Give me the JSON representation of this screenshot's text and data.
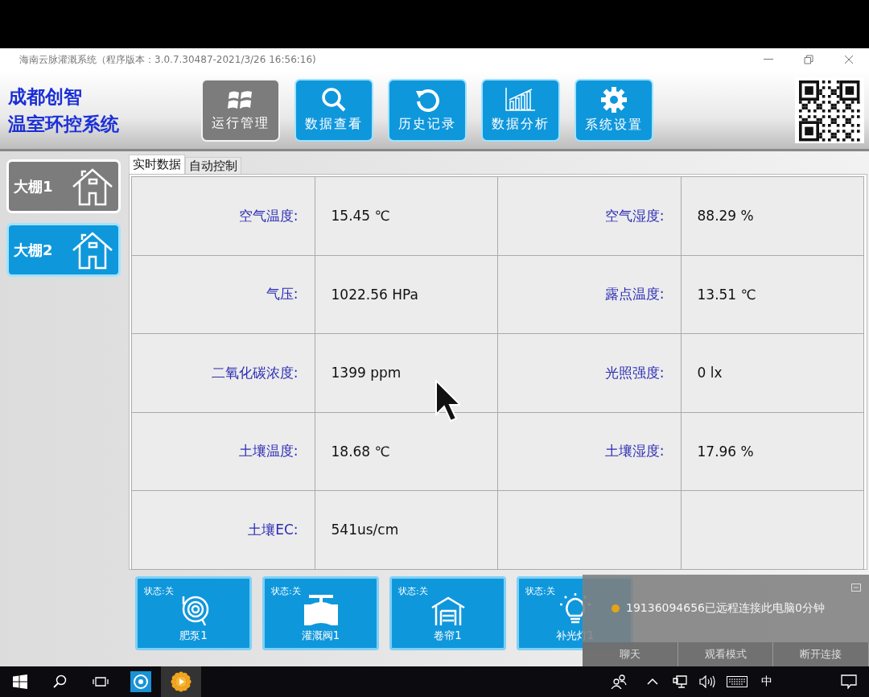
{
  "window": {
    "title": "海南云脉灌溉系统（程序版本：3.0.7.30487-2021/3/26 16:56:16)"
  },
  "brand": {
    "line1": "成都创智",
    "line2": "温室环控系统"
  },
  "nav": [
    {
      "label": "运行管理",
      "kind": "windows",
      "selected": true
    },
    {
      "label": "数据查看",
      "kind": "search",
      "selected": false
    },
    {
      "label": "历史记录",
      "kind": "history",
      "selected": false
    },
    {
      "label": "数据分析",
      "kind": "chart",
      "selected": false
    },
    {
      "label": "系统设置",
      "kind": "gear",
      "selected": false
    }
  ],
  "greenhouses": [
    {
      "label": "大棚1",
      "selected": true
    },
    {
      "label": "大棚2",
      "selected": false
    }
  ],
  "tabs": [
    {
      "label": "实时数据",
      "selected": true
    },
    {
      "label": "自动控制",
      "selected": false
    }
  ],
  "readings": [
    [
      {
        "label": "空气温度:",
        "value": "15.45 ℃"
      },
      {
        "label": "空气湿度:",
        "value": "88.29 %"
      }
    ],
    [
      {
        "label": "气压:",
        "value": "1022.56 HPa"
      },
      {
        "label": "露点温度:",
        "value": "13.51 ℃"
      }
    ],
    [
      {
        "label": "二氧化碳浓度:",
        "value": "1399 ppm"
      },
      {
        "label": "光照强度:",
        "value": "0 lx"
      }
    ],
    [
      {
        "label": "土壤温度:",
        "value": "18.68 ℃"
      },
      {
        "label": "土壤湿度:",
        "value": "17.96 %"
      }
    ],
    [
      {
        "label": "土壤EC:",
        "value": "541us/cm"
      }
    ]
  ],
  "devices": [
    {
      "status": "状态:关",
      "label": "肥泵1",
      "kind": "pump"
    },
    {
      "status": "状态:关",
      "label": "灌溉阀1",
      "kind": "valve"
    },
    {
      "status": "状态:关",
      "label": "卷帘1",
      "kind": "garage"
    },
    {
      "status": "状态:关",
      "label": "补光灯1",
      "kind": "bulb"
    }
  ],
  "notification": {
    "message": "19136094656已远程连接此电脑0分钟",
    "actions": [
      "聊天",
      "观看模式",
      "断开连接"
    ]
  },
  "taskbar": {
    "ime": "中"
  }
}
